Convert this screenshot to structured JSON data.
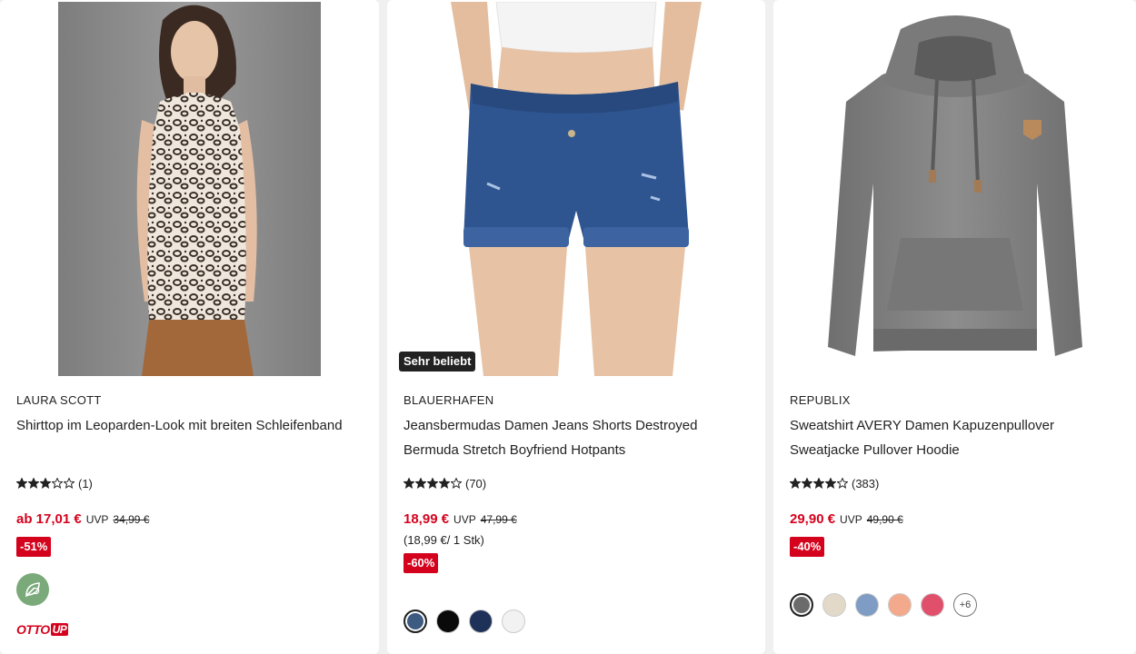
{
  "products": [
    {
      "brand": "LAURA SCOTT",
      "title": "Shirttop im Leoparden-Look mit breiten Schleifenband",
      "rating": {
        "stars": 3,
        "max": 5,
        "count": "(1)"
      },
      "price": "ab 17,01 €",
      "uvp_label": "UVP",
      "uvp_price": "34,99 €",
      "discount": "-51%",
      "image_icon": "leopard-top-photo",
      "sustainability_icon": "sustainability-leaf-icon",
      "logo_text": "OTTO",
      "logo_badge": "UP"
    },
    {
      "brand": "BLAUERHAFEN",
      "title": "Jeansbermudas Damen Jeans Shorts Destroyed Bermuda Stretch Boyfriend Hotpants",
      "badge": "Sehr beliebt",
      "rating": {
        "stars": 4,
        "max": 5,
        "count": "(70)"
      },
      "price": "18,99 €",
      "uvp_label": "UVP",
      "uvp_price": "47,99 €",
      "unit_price": "(18,99 €/ 1 Stk)",
      "discount": "-60%",
      "image_icon": "denim-shorts-photo",
      "swatches": [
        "#3d5a80",
        "#0a0a0a",
        "#1d3159",
        "#f2f2f2"
      ],
      "selected_swatch": 0
    },
    {
      "brand": "REPUBLIX",
      "title": "Sweatshirt AVERY Damen Kapuzenpullover Sweatjacke Pullover Hoodie",
      "rating": {
        "stars": 4,
        "max": 5,
        "count": "(383)"
      },
      "price": "29,90 €",
      "uvp_label": "UVP",
      "uvp_price": "49,90 €",
      "discount": "-40%",
      "image_icon": "grey-hoodie-photo",
      "swatches": [
        "#6b6b6b",
        "#e3d9c8",
        "#7f9cc4",
        "#f2a98c",
        "#e0506b"
      ],
      "selected_swatch": 0,
      "more_colors": "+6"
    }
  ],
  "colors": {
    "price_red": "#d4021d",
    "text": "#222222",
    "background": "#f0f0f0"
  }
}
